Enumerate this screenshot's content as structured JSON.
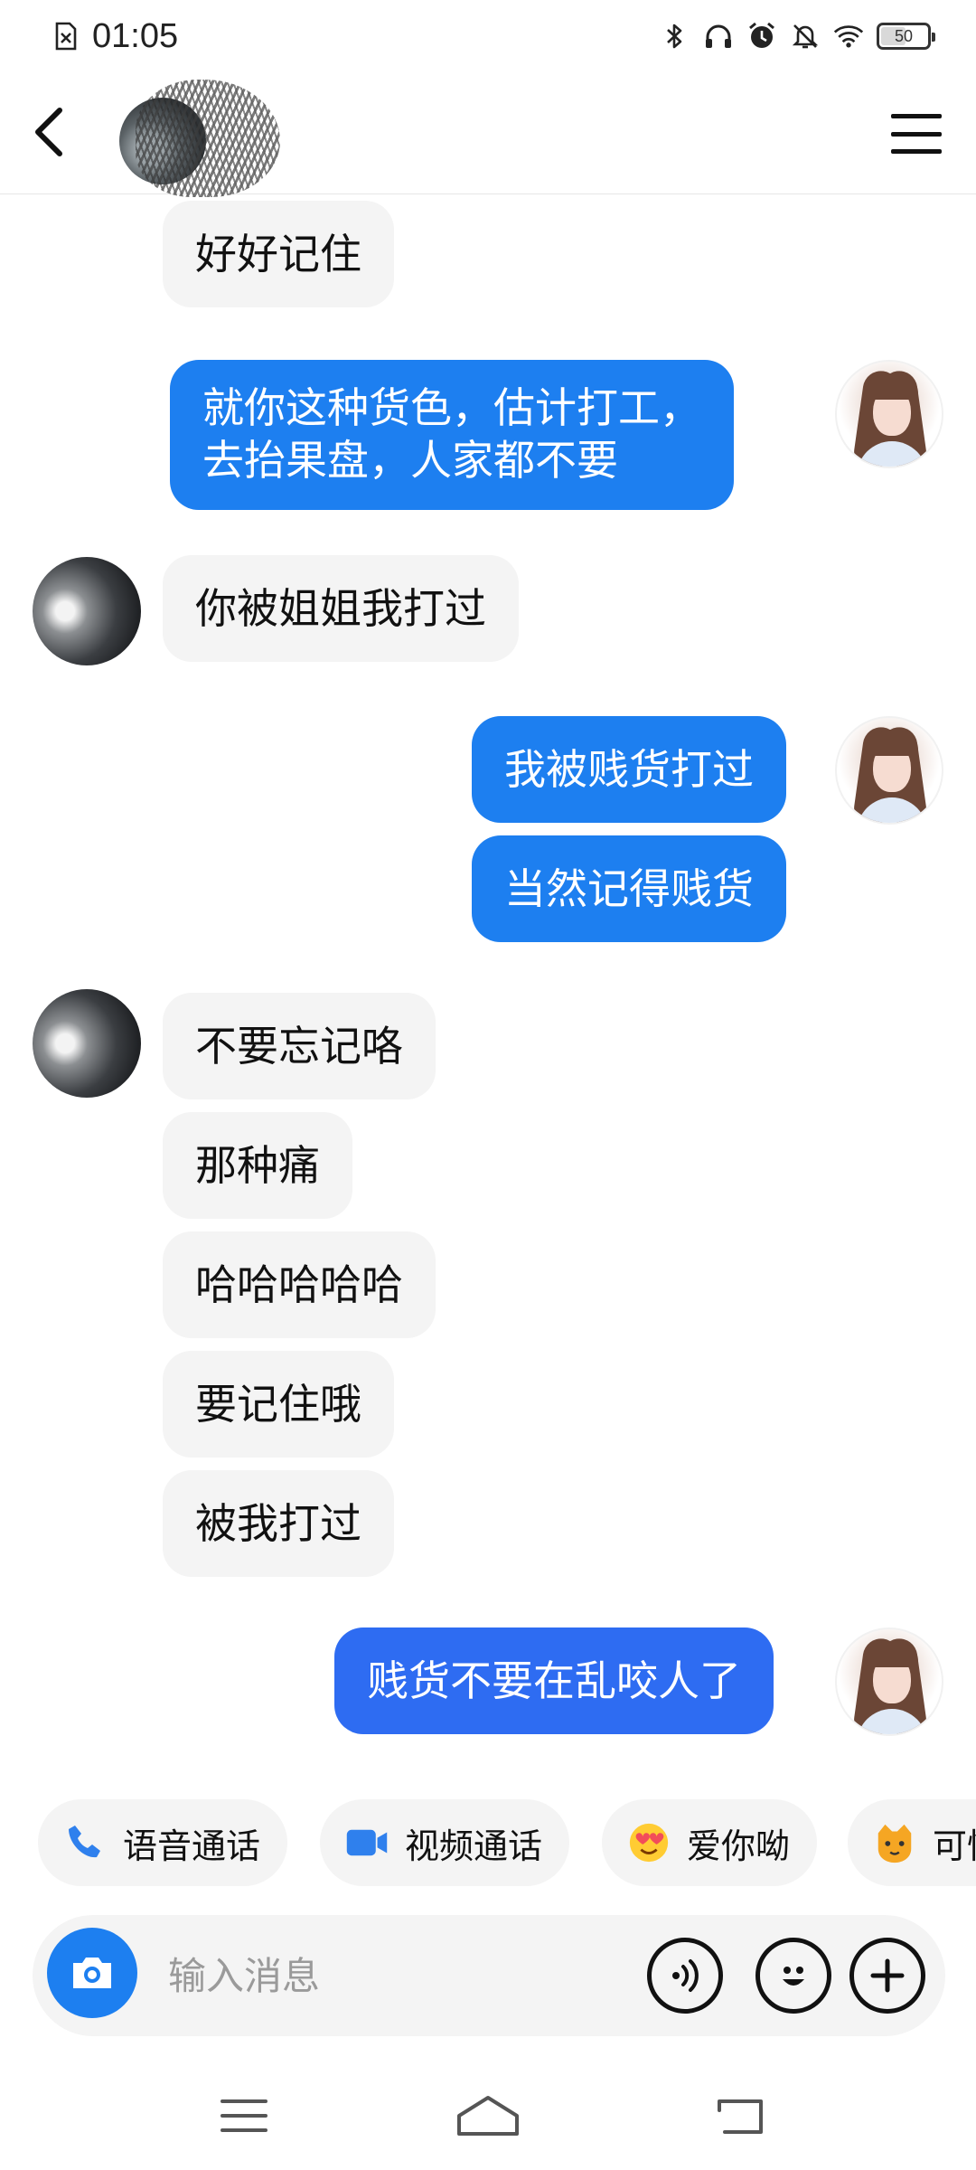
{
  "status_bar": {
    "time": "01:05",
    "battery_level": "50",
    "icons": [
      "sim-missing-icon",
      "bluetooth-icon",
      "headphones-icon",
      "alarm-icon",
      "mute-icon",
      "wifi-icon",
      "battery-icon"
    ]
  },
  "header": {
    "back_icon": "chevron-left-icon",
    "menu_icon": "hamburger-menu-icon"
  },
  "messages": [
    {
      "side": "in",
      "text": "好好记住"
    },
    {
      "side": "out",
      "lines": [
        "就你这种货色，估计打工，",
        "去抬果盘，人家都不要"
      ]
    },
    {
      "side": "in",
      "text": "你被姐姐我打过"
    },
    {
      "side": "out",
      "text": "我被贱货打过"
    },
    {
      "side": "out",
      "text": "当然记得贱货"
    },
    {
      "side": "in",
      "text": "不要忘记咯"
    },
    {
      "side": "in",
      "text": "那种痛"
    },
    {
      "side": "in",
      "text": "哈哈哈哈哈"
    },
    {
      "side": "in",
      "text": "要记住哦"
    },
    {
      "side": "in",
      "text": "被我打过"
    },
    {
      "side": "out",
      "text": "贱货不要在乱咬人了"
    }
  ],
  "quick_actions": [
    {
      "label": "语音通话",
      "icon": "phone-icon"
    },
    {
      "label": "视频通话",
      "icon": "video-camera-icon"
    },
    {
      "label": "爱你呦",
      "icon": "heart-eyes-emoji-icon"
    },
    {
      "label": "可怜",
      "icon": "cat-emoji-icon"
    }
  ],
  "input": {
    "placeholder": "输入消息",
    "value": ""
  },
  "colors": {
    "accent": "#1d7ff0",
    "incoming_bubble": "#f4f4f4",
    "outgoing_bubble": "#1d7ff0"
  },
  "nav_bar": {
    "icons": [
      "recent-apps-icon",
      "home-icon",
      "back-icon"
    ]
  }
}
